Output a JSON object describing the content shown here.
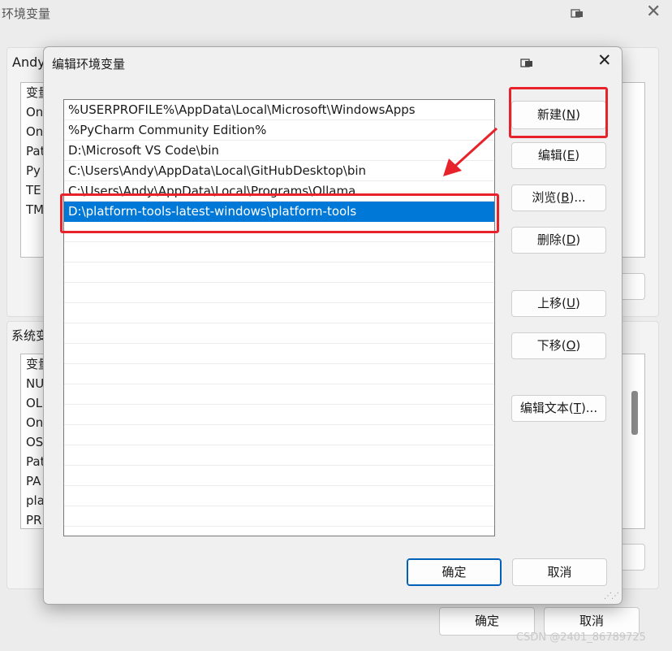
{
  "background_window": {
    "title": "环境变量",
    "user_section_label": "Andy",
    "user_list_header": "变量",
    "user_vars_truncated": [
      "On",
      "On",
      "Pat",
      "Py",
      "TE",
      "TM"
    ],
    "system_section_label": "系统变",
    "system_list_header": "变量",
    "system_vars_truncated": [
      "NU",
      "OL",
      "On",
      "OS",
      "Pat",
      "PA",
      "pla",
      "PR"
    ],
    "ok_label": "确定",
    "cancel_label": "取消"
  },
  "dialog": {
    "title": "编辑环境变量",
    "paths": [
      "%USERPROFILE%\\AppData\\Local\\Microsoft\\WindowsApps",
      "%PyCharm Community Edition%",
      "D:\\Microsoft VS Code\\bin",
      "C:\\Users\\Andy\\AppData\\Local\\GitHubDesktop\\bin",
      "C:\\Users\\Andy\\AppData\\Local\\Programs\\Ollama",
      "D:\\platform-tools-latest-windows\\platform-tools"
    ],
    "selected_path": "D:\\platform-tools-latest-windows\\platform-tools",
    "side_buttons": {
      "new": {
        "label": "新建(",
        "key": "N",
        "suffix": ")"
      },
      "edit": {
        "label": "编辑(",
        "key": "E",
        "suffix": ")"
      },
      "browse": {
        "label": "浏览(",
        "key": "B",
        "suffix": ")..."
      },
      "delete": {
        "label": "删除(",
        "key": "D",
        "suffix": ")"
      },
      "move_up": {
        "label": "上移(",
        "key": "U",
        "suffix": ")"
      },
      "move_down": {
        "label": "下移(",
        "key": "O",
        "suffix": ")"
      },
      "edit_text": {
        "label": "编辑文本(",
        "key": "T",
        "suffix": ")..."
      }
    },
    "ok_label": "确定",
    "cancel_label": "取消"
  },
  "watermark": "CSDN @2401_86789725",
  "colors": {
    "selection": "#0078d7",
    "annotation": "#e8222a",
    "primary_border": "#005fb8"
  }
}
